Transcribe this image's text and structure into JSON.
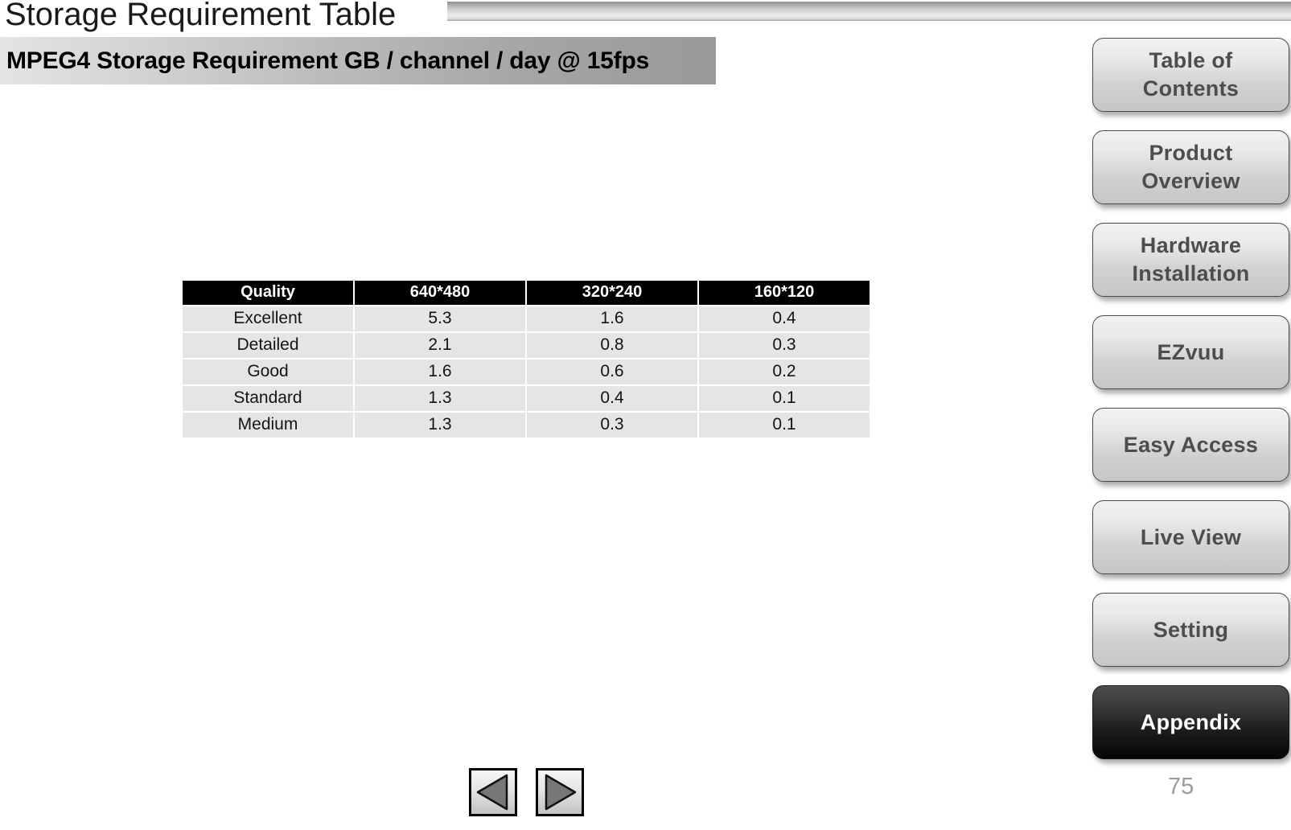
{
  "slide": {
    "title": "Storage Requirement Table",
    "banner_text": "MPEG4 Storage Requirement GB / channel / day @ 15fps",
    "page_number": "75"
  },
  "table": {
    "headers": [
      "Quality",
      "640*480",
      "320*240",
      "160*120"
    ],
    "rows": [
      [
        "Excellent",
        "5.3",
        "1.6",
        "0.4"
      ],
      [
        "Detailed",
        "2.1",
        "0.8",
        "0.3"
      ],
      [
        "Good",
        "1.6",
        "0.6",
        "0.2"
      ],
      [
        "Standard",
        "1.3",
        "0.4",
        "0.1"
      ],
      [
        "Medium",
        "1.3",
        "0.3",
        "0.1"
      ]
    ]
  },
  "sidebar": {
    "items": [
      {
        "label": "Table of\nContents",
        "active": false
      },
      {
        "label": "Product\nOverview",
        "active": false
      },
      {
        "label": "Hardware\nInstallation",
        "active": false
      },
      {
        "label": "EZvuu",
        "active": false
      },
      {
        "label": "Easy Access",
        "active": false
      },
      {
        "label": "Live View",
        "active": false
      },
      {
        "label": "Setting",
        "active": false
      },
      {
        "label": "Appendix",
        "active": true
      }
    ]
  },
  "navigation": {
    "previous_label": "previous-slide",
    "next_label": "next-slide"
  },
  "colors": {
    "header_bg": "#000000",
    "cell_bg": "#e5e5e5",
    "active_nav": "#1c1c1c",
    "page_number": "#9b9b9b"
  }
}
